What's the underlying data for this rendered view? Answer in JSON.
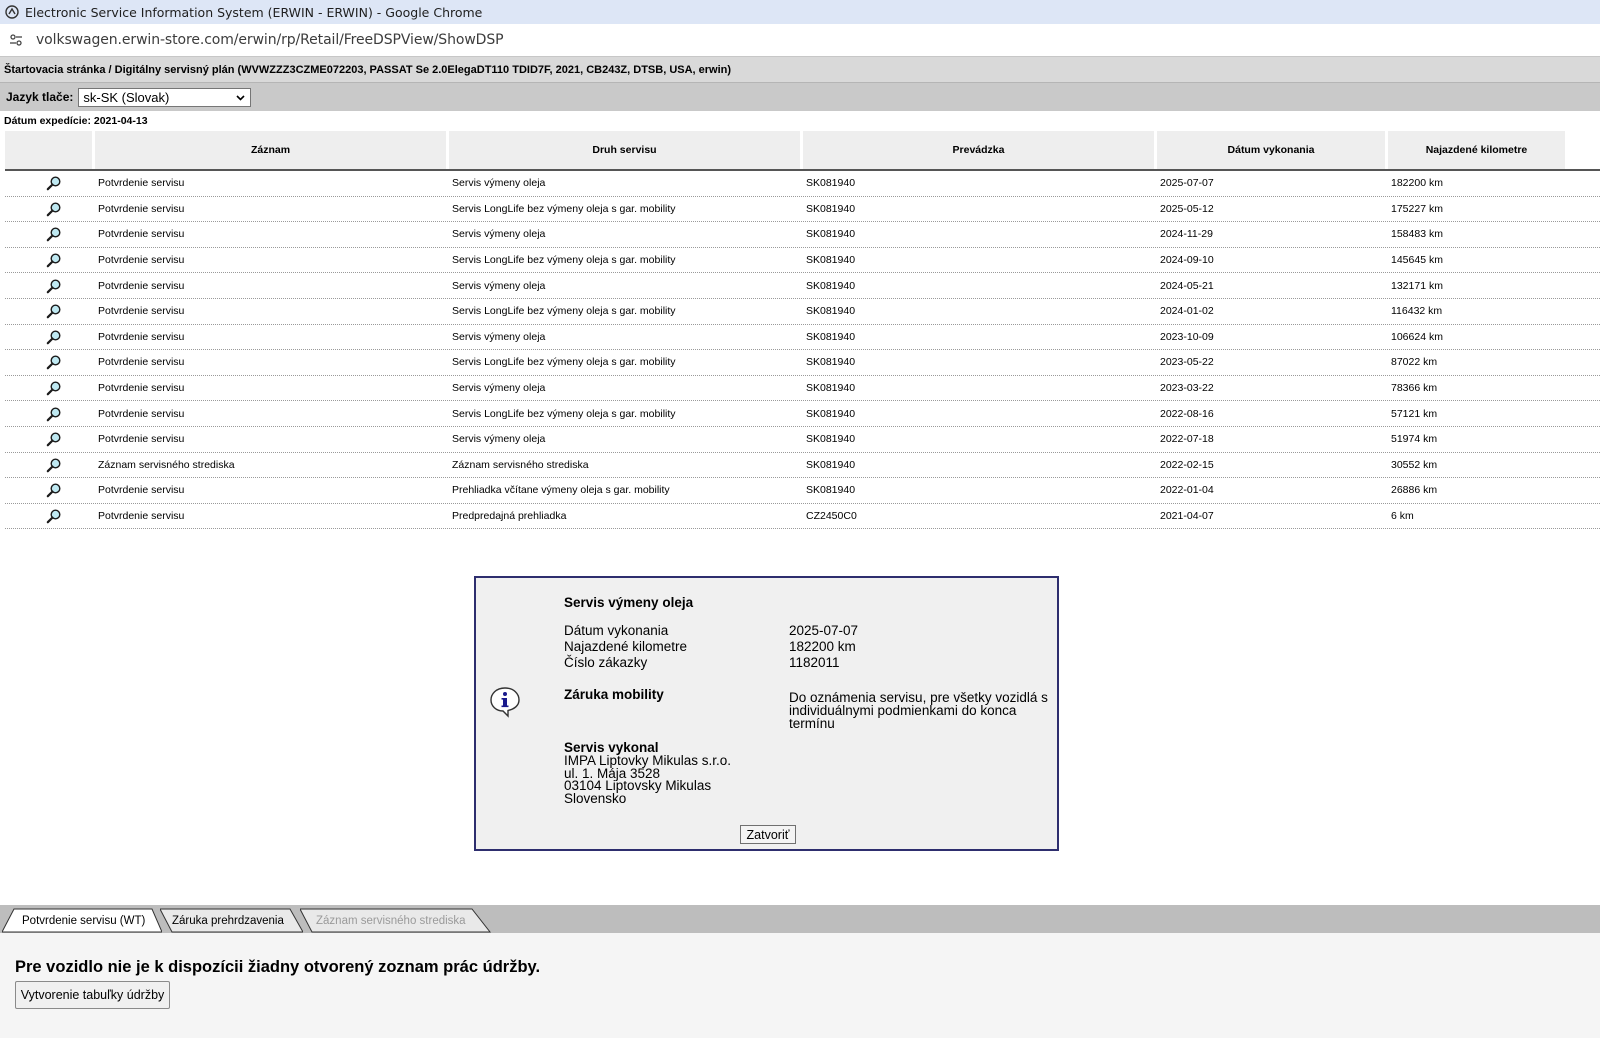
{
  "browser": {
    "window_title": "Electronic Service Information System (ERWIN - ERWIN) - Google Chrome",
    "url": "volkswagen.erwin-store.com/erwin/rp/Retail/FreeDSPView/ShowDSP"
  },
  "header": {
    "breadcrumb": "Štartovacia stránka / Digitálny servisný plán (WVWZZZ3CZME072203, PASSAT Se 2.0ElegaDT110 TDID7F, 2021, CB243Z, DTSB, USA, erwin)",
    "print_language_label": "Jazyk tlače:",
    "print_language_value": "sk-SK (Slovak)",
    "expedition_date": "Dátum expedície: 2021-04-13"
  },
  "table": {
    "columns": [
      "",
      "Záznam",
      "Druh servisu",
      "Prevádzka",
      "Dátum vykonania",
      "Najazdené kilometre"
    ],
    "rows": [
      {
        "icon": "magnifier-icon",
        "record": "Potvrdenie servisu",
        "service_type": "Servis výmeny oleja",
        "workshop": "SK081940",
        "date": "2025-07-07",
        "km": "182200 km"
      },
      {
        "icon": "magnifier-icon",
        "record": "Potvrdenie servisu",
        "service_type": "Servis LongLife bez výmeny oleja s gar. mobility",
        "workshop": "SK081940",
        "date": "2025-05-12",
        "km": "175227 km"
      },
      {
        "icon": "magnifier-icon",
        "record": "Potvrdenie servisu",
        "service_type": "Servis výmeny oleja",
        "workshop": "SK081940",
        "date": "2024-11-29",
        "km": "158483 km"
      },
      {
        "icon": "magnifier-icon",
        "record": "Potvrdenie servisu",
        "service_type": "Servis LongLife bez výmeny oleja s gar. mobility",
        "workshop": "SK081940",
        "date": "2024-09-10",
        "km": "145645 km"
      },
      {
        "icon": "magnifier-icon",
        "record": "Potvrdenie servisu",
        "service_type": "Servis výmeny oleja",
        "workshop": "SK081940",
        "date": "2024-05-21",
        "km": "132171 km"
      },
      {
        "icon": "magnifier-icon",
        "record": "Potvrdenie servisu",
        "service_type": "Servis LongLife bez výmeny oleja s gar. mobility",
        "workshop": "SK081940",
        "date": "2024-01-02",
        "km": "116432 km"
      },
      {
        "icon": "magnifier-icon",
        "record": "Potvrdenie servisu",
        "service_type": "Servis výmeny oleja",
        "workshop": "SK081940",
        "date": "2023-10-09",
        "km": "106624 km"
      },
      {
        "icon": "magnifier-icon",
        "record": "Potvrdenie servisu",
        "service_type": "Servis LongLife bez výmeny oleja s gar. mobility",
        "workshop": "SK081940",
        "date": "2023-05-22",
        "km": "87022 km"
      },
      {
        "icon": "magnifier-icon",
        "record": "Potvrdenie servisu",
        "service_type": "Servis výmeny oleja",
        "workshop": "SK081940",
        "date": "2023-03-22",
        "km": "78366 km"
      },
      {
        "icon": "magnifier-icon",
        "record": "Potvrdenie servisu",
        "service_type": "Servis LongLife bez výmeny oleja s gar. mobility",
        "workshop": "SK081940",
        "date": "2022-08-16",
        "km": "57121 km"
      },
      {
        "icon": "magnifier-icon",
        "record": "Potvrdenie servisu",
        "service_type": "Servis výmeny oleja",
        "workshop": "SK081940",
        "date": "2022-07-18",
        "km": "51974 km"
      },
      {
        "icon": "magnifier-icon",
        "record": "Záznam servisného strediska",
        "service_type": "Záznam servisného strediska",
        "workshop": "SK081940",
        "date": "2022-02-15",
        "km": "30552 km"
      },
      {
        "icon": "magnifier-icon",
        "record": "Potvrdenie servisu",
        "service_type": "Prehliadka včítane výmeny oleja s gar. mobility",
        "workshop": "SK081940",
        "date": "2022-01-04",
        "km": "26886 km"
      },
      {
        "icon": "magnifier-icon",
        "record": "Potvrdenie servisu",
        "service_type": "Predpredajná prehliadka",
        "workshop": "CZ2450C0",
        "date": "2021-04-07",
        "km": "6 km"
      }
    ]
  },
  "dialog": {
    "title": "Servis výmeny oleja",
    "date_label": "Dátum vykonania",
    "date_value": "2025-07-07",
    "km_label": "Najazdené kilometre",
    "km_value": "182200 km",
    "order_label": "Číslo zákazky",
    "order_value": "1182011",
    "mobility_label": "Záruka mobility",
    "mobility_text": "Do oznámenia servisu, pre všetky vozidlá s individuálnymi podmienkami do konca termínu",
    "performed_by_label": "Servis vykonal",
    "address_lines": [
      "IMPA Liptovky Mikulas s.r.o.",
      "ul. 1. Mája 3528",
      "03104 Liptovsky Mikulas",
      "Slovensko"
    ],
    "close_label": "Zatvoriť",
    "icon": "info-icon"
  },
  "tabs": [
    {
      "label": "Potvrdenie servisu (WT)",
      "state": "active"
    },
    {
      "label": "Záruka prehrdzavenia",
      "state": "normal"
    },
    {
      "label": "Záznam servisného strediska",
      "state": "disabled"
    }
  ],
  "panel": {
    "message": "Pre vozidlo nie je k dispozícii žiadny otvorený zoznam prác údržby.",
    "create_button": "Vytvorenie tabuľky údržby"
  },
  "colors": {
    "titlebar_bg": "#dde6f6",
    "crumbbar_bg": "#d9d9d9",
    "langbar_bg": "#c9c9c9",
    "dialog_border": "#2e2e6e",
    "disabled_tab_text": "#9a9a9a"
  }
}
